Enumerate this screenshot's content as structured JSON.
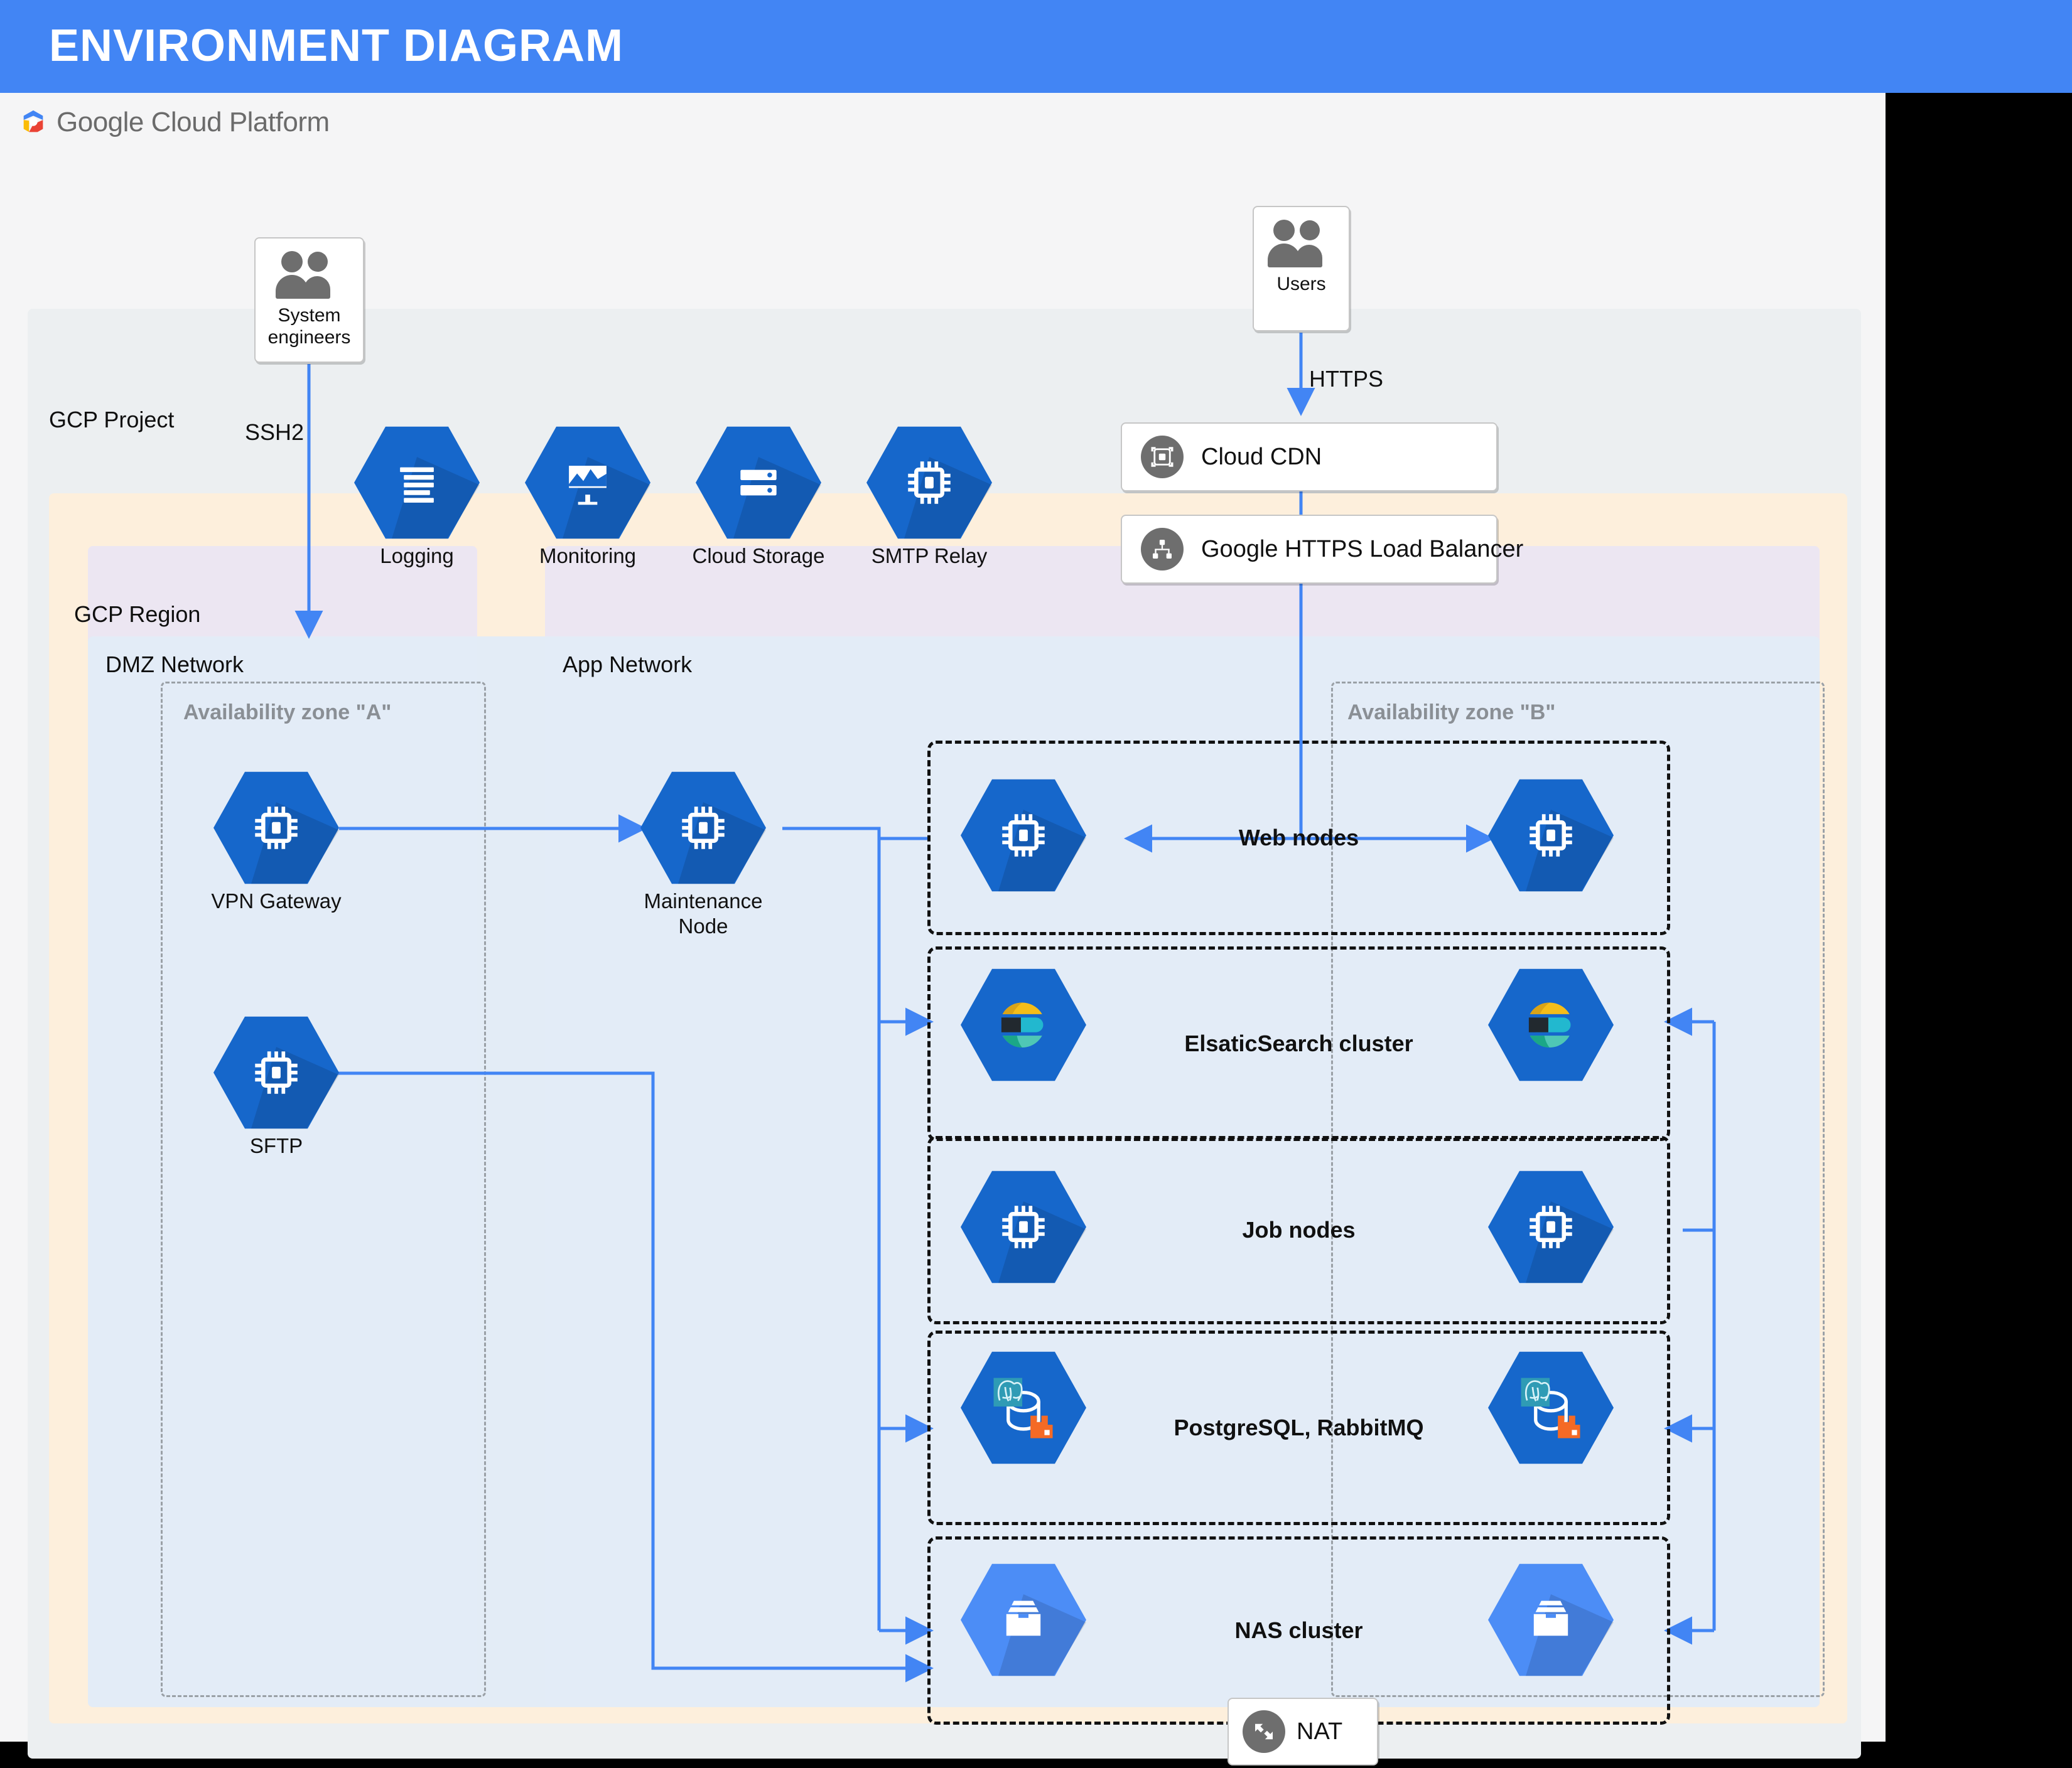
{
  "header": {
    "title": "ENVIRONMENT DIAGRAM",
    "bg": "#4285f4"
  },
  "brand": {
    "google": "Google",
    "cloud_platform": "Cloud Platform"
  },
  "zones": {
    "project": "GCP Project",
    "region": "GCP Region",
    "dmz_network": "DMZ Network",
    "app_network": "App Network",
    "az_a": "Availability zone \"A\"",
    "az_b": "Availability zone \"B\""
  },
  "actors": {
    "system_engineers": {
      "line1": "System",
      "line2": "engineers",
      "icon": "people-icon"
    },
    "users": {
      "label": "Users",
      "icon": "people-icon"
    }
  },
  "edges": {
    "ssh2": "SSH2",
    "https": "HTTPS"
  },
  "managed_services": [
    {
      "label": "Logging",
      "icon": "logging-icon"
    },
    {
      "label": "Monitoring",
      "icon": "monitoring-icon"
    },
    {
      "label": "Cloud Storage",
      "icon": "cloud-storage-icon"
    },
    {
      "label": "SMTP Relay",
      "icon": "cpu-icon"
    }
  ],
  "edge_services": [
    {
      "label": "Cloud CDN",
      "icon": "cdn-icon"
    },
    {
      "label": "Google HTTPS Load Balancer",
      "icon": "load-balancer-icon"
    }
  ],
  "dmz_nodes": [
    {
      "label": "VPN Gateway",
      "icon": "cpu-icon"
    },
    {
      "label": "SFTP",
      "icon": "cpu-icon"
    }
  ],
  "app_nodes": [
    {
      "line1": "Maintenance",
      "line2": "Node",
      "icon": "cpu-icon"
    }
  ],
  "clusters": [
    {
      "label": "Web nodes",
      "icon": "cpu-icon"
    },
    {
      "label": "ElsaticSearch cluster",
      "icon": "elasticsearch-icon"
    },
    {
      "label": "Job nodes",
      "icon": "cpu-icon"
    },
    {
      "label": "PostgreSQL, RabbitMQ",
      "icon": "postgres-rabbitmq-icon"
    },
    {
      "label": "NAS cluster",
      "icon": "nas-icon"
    }
  ],
  "nat": {
    "label": "NAT",
    "icon": "nat-icon"
  },
  "colors": {
    "header": "#4285f4",
    "canvas": "#f5f5f6",
    "project": "#eceff1",
    "region": "#fdefdc",
    "network": "#e9e5f5",
    "zone_inner": "#e2ebf7",
    "hex_blue": "#1667cb",
    "hex_light_blue": "#4c8df6",
    "wire": "#4285f4",
    "elastic_yellow": "#f4bd19",
    "elastic_cyan": "#00bfb3",
    "elastic_teal": "#22b8cf",
    "rabbit_orange": "#f56a25",
    "postgres_blue": "#2f9bb5"
  }
}
